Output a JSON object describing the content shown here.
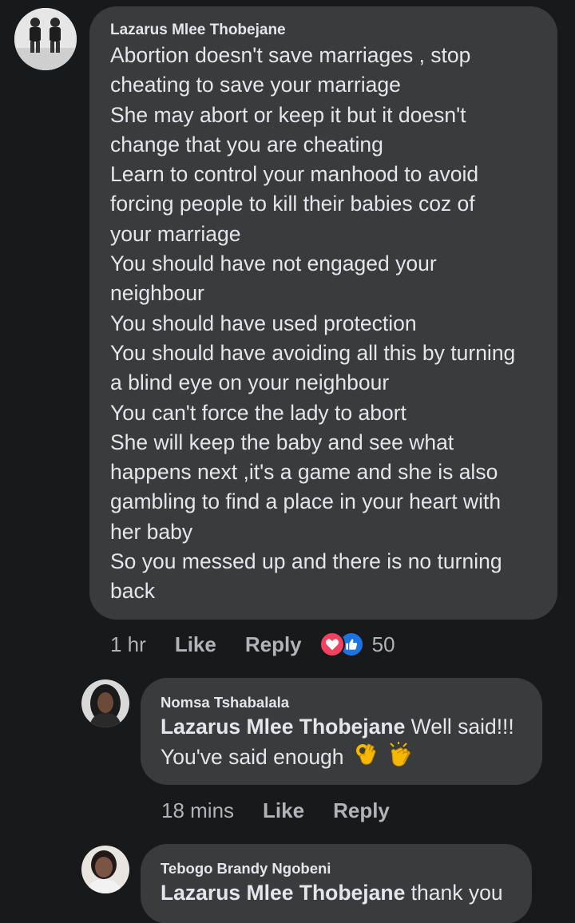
{
  "comment1": {
    "author": "Lazarus Mlee Thobejane",
    "avatar_icon": "profile-photo-two-men",
    "lines": [
      "Abortion doesn't save marriages , stop",
      "cheating to save your marriage",
      "She may abort or keep it but it doesn't",
      "change that you are cheating",
      "Learn to control your manhood to avoid",
      "forcing people to kill their babies coz of",
      "your marriage",
      "You should have not engaged your",
      "neighbour",
      "You should have used protection",
      "You should have avoiding all this by turning",
      "a blind eye on your neighbour",
      "You can't force the lady to abort",
      "She will keep the baby and see what",
      "happens next ,it's a game and she is also",
      "gambling to find a place in your heart with",
      "her baby",
      "So you messed up and there is no turning",
      "back"
    ],
    "time": "1 hr",
    "like_label": "Like",
    "reply_label": "Reply",
    "reaction_count": "50",
    "reaction_icons": [
      "love-reaction-icon",
      "like-reaction-icon"
    ]
  },
  "reply1": {
    "author": "Nomsa Tshabalala",
    "avatar_icon": "profile-photo-woman",
    "mention": "Lazarus Mlee Thobejane",
    "text_after_mention": " Well said!!!",
    "line2": "You've said enough",
    "emojis": [
      "ok-hand-emoji",
      "clapping-hands-emoji"
    ],
    "time": "18 mins",
    "like_label": "Like",
    "reply_label": "Reply"
  },
  "reply2": {
    "author": "Tebogo Brandy Ngobeni",
    "avatar_icon": "profile-photo-woman-2",
    "mention": "Lazarus Mlee Thobejane",
    "text_after_mention": " thank you"
  },
  "colors": {
    "background": "#18191a",
    "bubble": "#3a3b3c",
    "text": "#e4e6eb",
    "secondary_text": "#b0b3b8",
    "love": "#f3425f",
    "like": "#1b74e4"
  }
}
